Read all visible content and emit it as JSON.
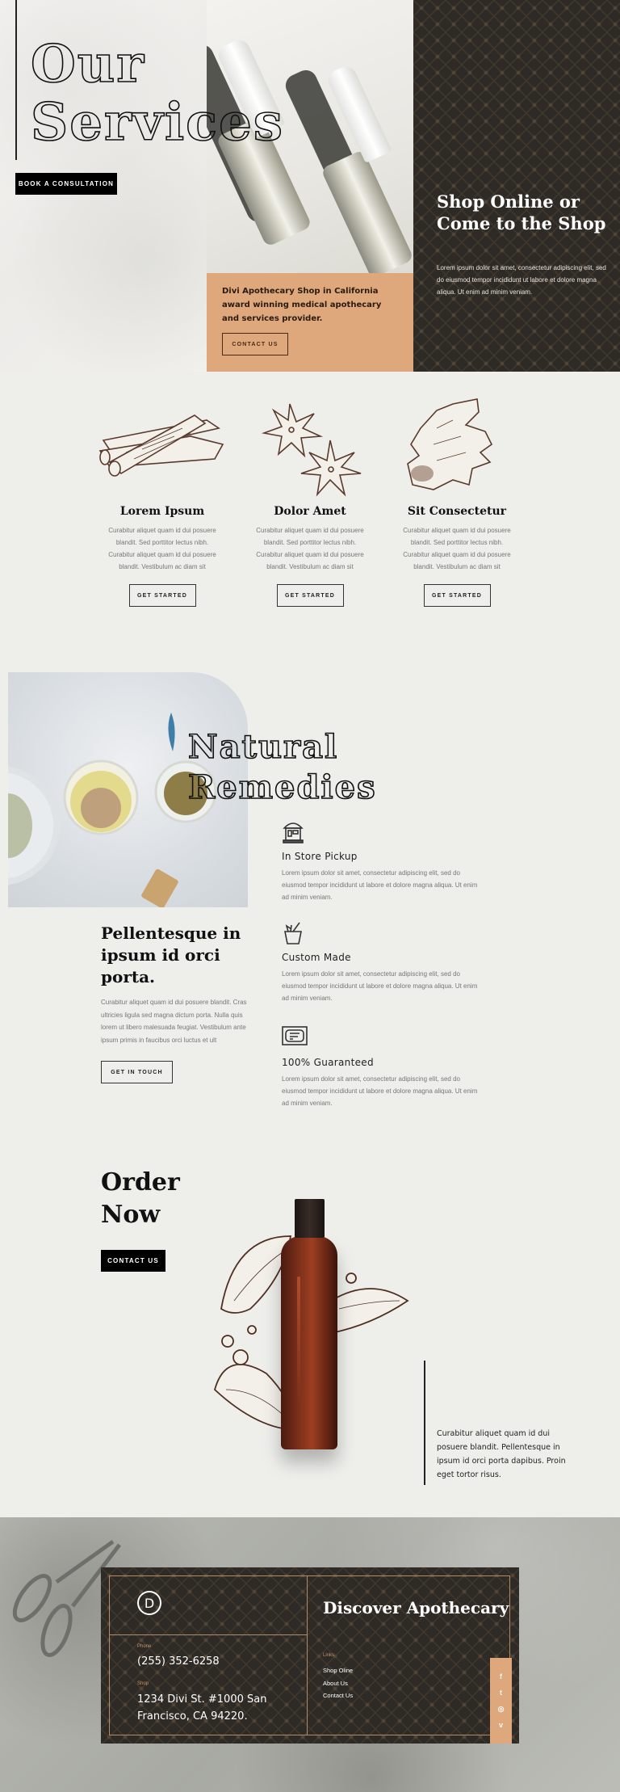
{
  "hero": {
    "title_line1": "Our",
    "title_line2": "Services",
    "book_button": "BOOK A CONSULTATION",
    "tan_text": "Divi Apothecary Shop in California award winning medical apothecary and services provider.",
    "contact_button": "CONTACT US",
    "shop_heading": "Shop Online or Come to the Shop",
    "shop_text": "Lorem ipsum dolor sit amet, consectetur adipiscing elit, sed do eiusmod tempor incididunt ut labore et dolore magna aliqua. Ut enim ad minim veniam."
  },
  "services": {
    "items": [
      {
        "title": "Lorem Ipsum",
        "illustration": "cinnamon-sticks",
        "text": "Curabitur aliquet quam id dui posuere blandit. Sed porttitor lectus nibh. Curabitur aliquet quam id dui posuere blandit. Vestibulum ac diam sit",
        "button": "GET STARTED"
      },
      {
        "title": "Dolor Amet",
        "illustration": "star-anise",
        "text": "Curabitur aliquet quam id dui posuere blandit. Sed porttitor lectus nibh. Curabitur aliquet quam id dui posuere blandit. Vestibulum ac diam sit",
        "button": "GET STARTED"
      },
      {
        "title": "Sit Consectetur",
        "illustration": "ginger-root",
        "text": "Curabitur aliquet quam id dui posuere blandit. Sed porttitor lectus nibh. Curabitur aliquet quam id dui posuere blandit. Vestibulum ac diam sit",
        "button": "GET STARTED"
      }
    ]
  },
  "remedies": {
    "title_line1": "Natural",
    "title_line2": "Remedies",
    "features": [
      {
        "icon": "store-icon",
        "title": "In Store Pickup",
        "text": "Lorem ipsum dolor sit amet, consectetur adipiscing elit, sed do eiusmod tempor incididunt ut labore et dolore magna aliqua. Ut enim ad minim veniam."
      },
      {
        "icon": "mortar-pestle-icon",
        "title": "Custom Made",
        "text": "Lorem ipsum dolor sit amet, consectetur adipiscing elit, sed do eiusmod tempor incididunt ut labore et dolore magna aliqua. Ut enim ad minim veniam."
      },
      {
        "icon": "certificate-icon",
        "title": "100% Guaranteed",
        "text": "Lorem ipsum dolor sit amet, consectetur adipiscing elit, sed do eiusmod tempor incididunt ut labore et dolore magna aliqua. Ut enim ad minim veniam."
      }
    ],
    "pell_heading": "Pellentesque in ipsum id orci porta.",
    "pell_text": "Curabitur aliquet quam id dui posuere blandit. Cras ultricies ligula sed magna dictum porta. Nulla quis lorem ut libero malesuada feugiat. Vestibulum ante ipsum primis in faucibus orci luctus et ult",
    "pell_button": "GET IN TOUCH"
  },
  "order": {
    "title_line1": "Order",
    "title_line2": "Now",
    "button": "CONTACT US",
    "text": "Curabitur aliquet quam id dui posuere blandit. Pellentesque in ipsum id orci porta dapibus. Proin eget tortor risus."
  },
  "footer": {
    "logo_letter": "D",
    "phone_label": "Phone",
    "phone": "(255) 352-6258",
    "shop_label": "Shop",
    "address": "1234 Divi St. #1000 San Francisco, CA 94220.",
    "heading": "Discover Apothecary",
    "links_label": "Links",
    "links": [
      "Shop Oline",
      "About Us",
      "Contact Us"
    ],
    "social": [
      {
        "name": "facebook-icon",
        "glyph": "f"
      },
      {
        "name": "twitter-icon",
        "glyph": "t"
      },
      {
        "name": "instagram-icon",
        "glyph": "◎"
      },
      {
        "name": "vimeo-icon",
        "glyph": "v"
      }
    ]
  },
  "colors": {
    "tan": "#dea77c",
    "dark": "#2e2b27",
    "background": "#eeeeeb",
    "frame": "#b48a63"
  }
}
